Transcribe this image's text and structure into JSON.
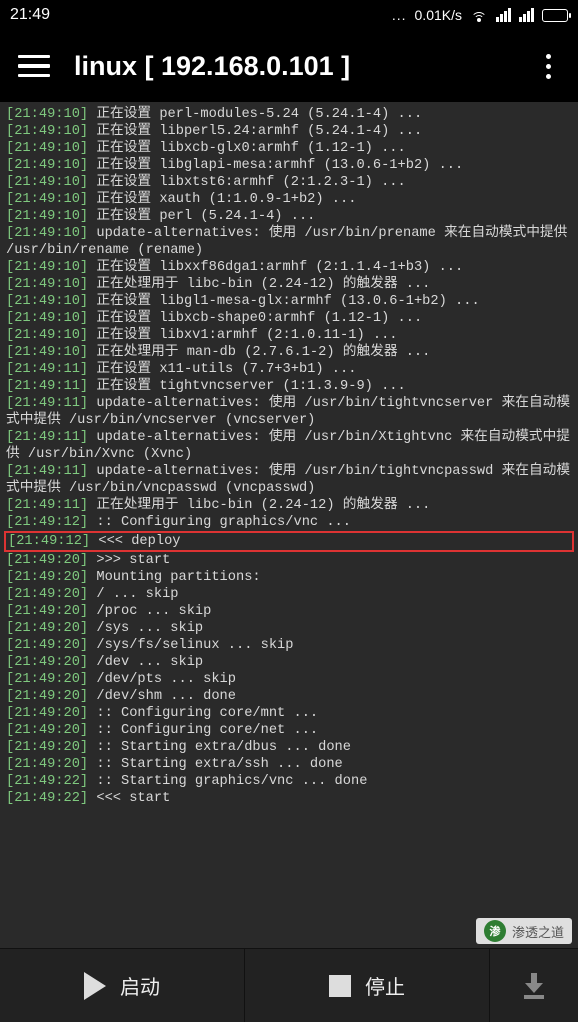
{
  "status": {
    "time": "21:49",
    "net_speed": "0.01K/s",
    "dots": "..."
  },
  "header": {
    "title": "linux  [ 192.168.0.101 ]"
  },
  "log": [
    {
      "ts": "[21:49:10]",
      "msg": " 正在设置 perl-modules-5.24 (5.24.1-4) ...",
      "hl": false
    },
    {
      "ts": "[21:49:10]",
      "msg": " 正在设置 libperl5.24:armhf (5.24.1-4) ...",
      "hl": false
    },
    {
      "ts": "[21:49:10]",
      "msg": " 正在设置 libxcb-glx0:armhf (1.12-1) ...",
      "hl": false
    },
    {
      "ts": "[21:49:10]",
      "msg": " 正在设置 libglapi-mesa:armhf (13.0.6-1+b2) ...",
      "hl": false
    },
    {
      "ts": "[21:49:10]",
      "msg": " 正在设置 libxtst6:armhf (2:1.2.3-1) ...",
      "hl": false
    },
    {
      "ts": "[21:49:10]",
      "msg": " 正在设置 xauth (1:1.0.9-1+b2) ...",
      "hl": false
    },
    {
      "ts": "[21:49:10]",
      "msg": " 正在设置 perl (5.24.1-4) ...",
      "hl": false
    },
    {
      "ts": "[21:49:10]",
      "msg": " update-alternatives: 使用 /usr/bin/prename 来在自动模式中提供 /usr/bin/rename (rename)",
      "hl": false
    },
    {
      "ts": "[21:49:10]",
      "msg": " 正在设置 libxxf86dga1:armhf (2:1.1.4-1+b3) ...",
      "hl": false
    },
    {
      "ts": "[21:49:10]",
      "msg": " 正在处理用于 libc-bin (2.24-12) 的触发器 ...",
      "hl": false
    },
    {
      "ts": "[21:49:10]",
      "msg": " 正在设置 libgl1-mesa-glx:armhf (13.0.6-1+b2) ...",
      "hl": false
    },
    {
      "ts": "[21:49:10]",
      "msg": " 正在设置 libxcb-shape0:armhf (1.12-1) ...",
      "hl": false
    },
    {
      "ts": "[21:49:10]",
      "msg": " 正在设置 libxv1:armhf (2:1.0.11-1) ...",
      "hl": false
    },
    {
      "ts": "[21:49:10]",
      "msg": " 正在处理用于 man-db (2.7.6.1-2) 的触发器 ...",
      "hl": false
    },
    {
      "ts": "[21:49:11]",
      "msg": " 正在设置 x11-utils (7.7+3+b1) ...",
      "hl": false
    },
    {
      "ts": "[21:49:11]",
      "msg": " 正在设置 tightvncserver (1:1.3.9-9) ...",
      "hl": false
    },
    {
      "ts": "[21:49:11]",
      "msg": " update-alternatives: 使用 /usr/bin/tightvncserver 来在自动模式中提供 /usr/bin/vncserver (vncserver)",
      "hl": false
    },
    {
      "ts": "[21:49:11]",
      "msg": " update-alternatives: 使用 /usr/bin/Xtightvnc 来在自动模式中提供 /usr/bin/Xvnc (Xvnc)",
      "hl": false
    },
    {
      "ts": "[21:49:11]",
      "msg": " update-alternatives: 使用 /usr/bin/tightvncpasswd 来在自动模式中提供 /usr/bin/vncpasswd (vncpasswd)",
      "hl": false
    },
    {
      "ts": "[21:49:11]",
      "msg": " 正在处理用于 libc-bin (2.24-12) 的触发器 ...",
      "hl": false
    },
    {
      "ts": "[21:49:12]",
      "msg": " :: Configuring graphics/vnc ...",
      "hl": false
    },
    {
      "ts": "[21:49:12]",
      "msg": " <<< deploy",
      "hl": true
    },
    {
      "ts": "[21:49:20]",
      "msg": " >>> start",
      "hl": false
    },
    {
      "ts": "[21:49:20]",
      "msg": " Mounting partitions:",
      "hl": false
    },
    {
      "ts": "[21:49:20]",
      "msg": " / ... skip",
      "hl": false
    },
    {
      "ts": "[21:49:20]",
      "msg": " /proc ... skip",
      "hl": false
    },
    {
      "ts": "[21:49:20]",
      "msg": " /sys ... skip",
      "hl": false
    },
    {
      "ts": "[21:49:20]",
      "msg": " /sys/fs/selinux ... skip",
      "hl": false
    },
    {
      "ts": "[21:49:20]",
      "msg": " /dev ... skip",
      "hl": false
    },
    {
      "ts": "[21:49:20]",
      "msg": " /dev/pts ... skip",
      "hl": false
    },
    {
      "ts": "[21:49:20]",
      "msg": " /dev/shm ... done",
      "hl": false
    },
    {
      "ts": "[21:49:20]",
      "msg": " :: Configuring core/mnt ...",
      "hl": false
    },
    {
      "ts": "[21:49:20]",
      "msg": " :: Configuring core/net ...",
      "hl": false
    },
    {
      "ts": "[21:49:20]",
      "msg": " :: Starting extra/dbus ... done",
      "hl": false
    },
    {
      "ts": "[21:49:20]",
      "msg": " :: Starting extra/ssh ... done",
      "hl": false
    },
    {
      "ts": "[21:49:22]",
      "msg": " :: Starting graphics/vnc ... done",
      "hl": false
    },
    {
      "ts": "[21:49:22]",
      "msg": " <<< start",
      "hl": false
    }
  ],
  "bottom": {
    "start": "启动",
    "stop": "停止"
  },
  "watermark": {
    "icon_text": "渗",
    "label": "渗透之道"
  }
}
